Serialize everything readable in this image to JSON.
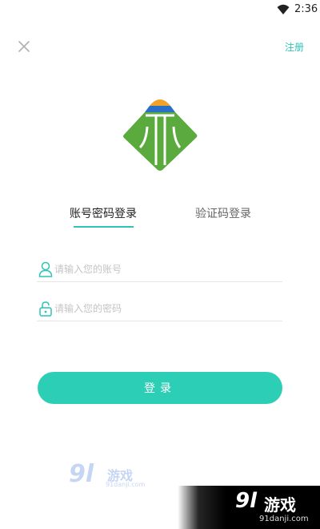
{
  "status_bar": {
    "time": "2:36"
  },
  "header": {
    "register_label": "注册"
  },
  "tabs": [
    {
      "label": "账号密码登录",
      "active": true
    },
    {
      "label": "验证码登录",
      "active": false
    }
  ],
  "form": {
    "account_placeholder": "请输入您的账号",
    "password_placeholder": "请输入您的密码",
    "login_label": "登录"
  },
  "watermark": {
    "number": "9l",
    "text": "游戏",
    "url": "91danji.com"
  },
  "colors": {
    "accent": "#2ec4b6",
    "button": "#2ccfb5",
    "logo_orange": "#f0a229",
    "logo_blue": "#2a6fc6",
    "logo_green": "#5aaa3d"
  },
  "icons": [
    "wifi-icon",
    "close-icon",
    "user-icon",
    "lock-icon",
    "app-logo"
  ]
}
